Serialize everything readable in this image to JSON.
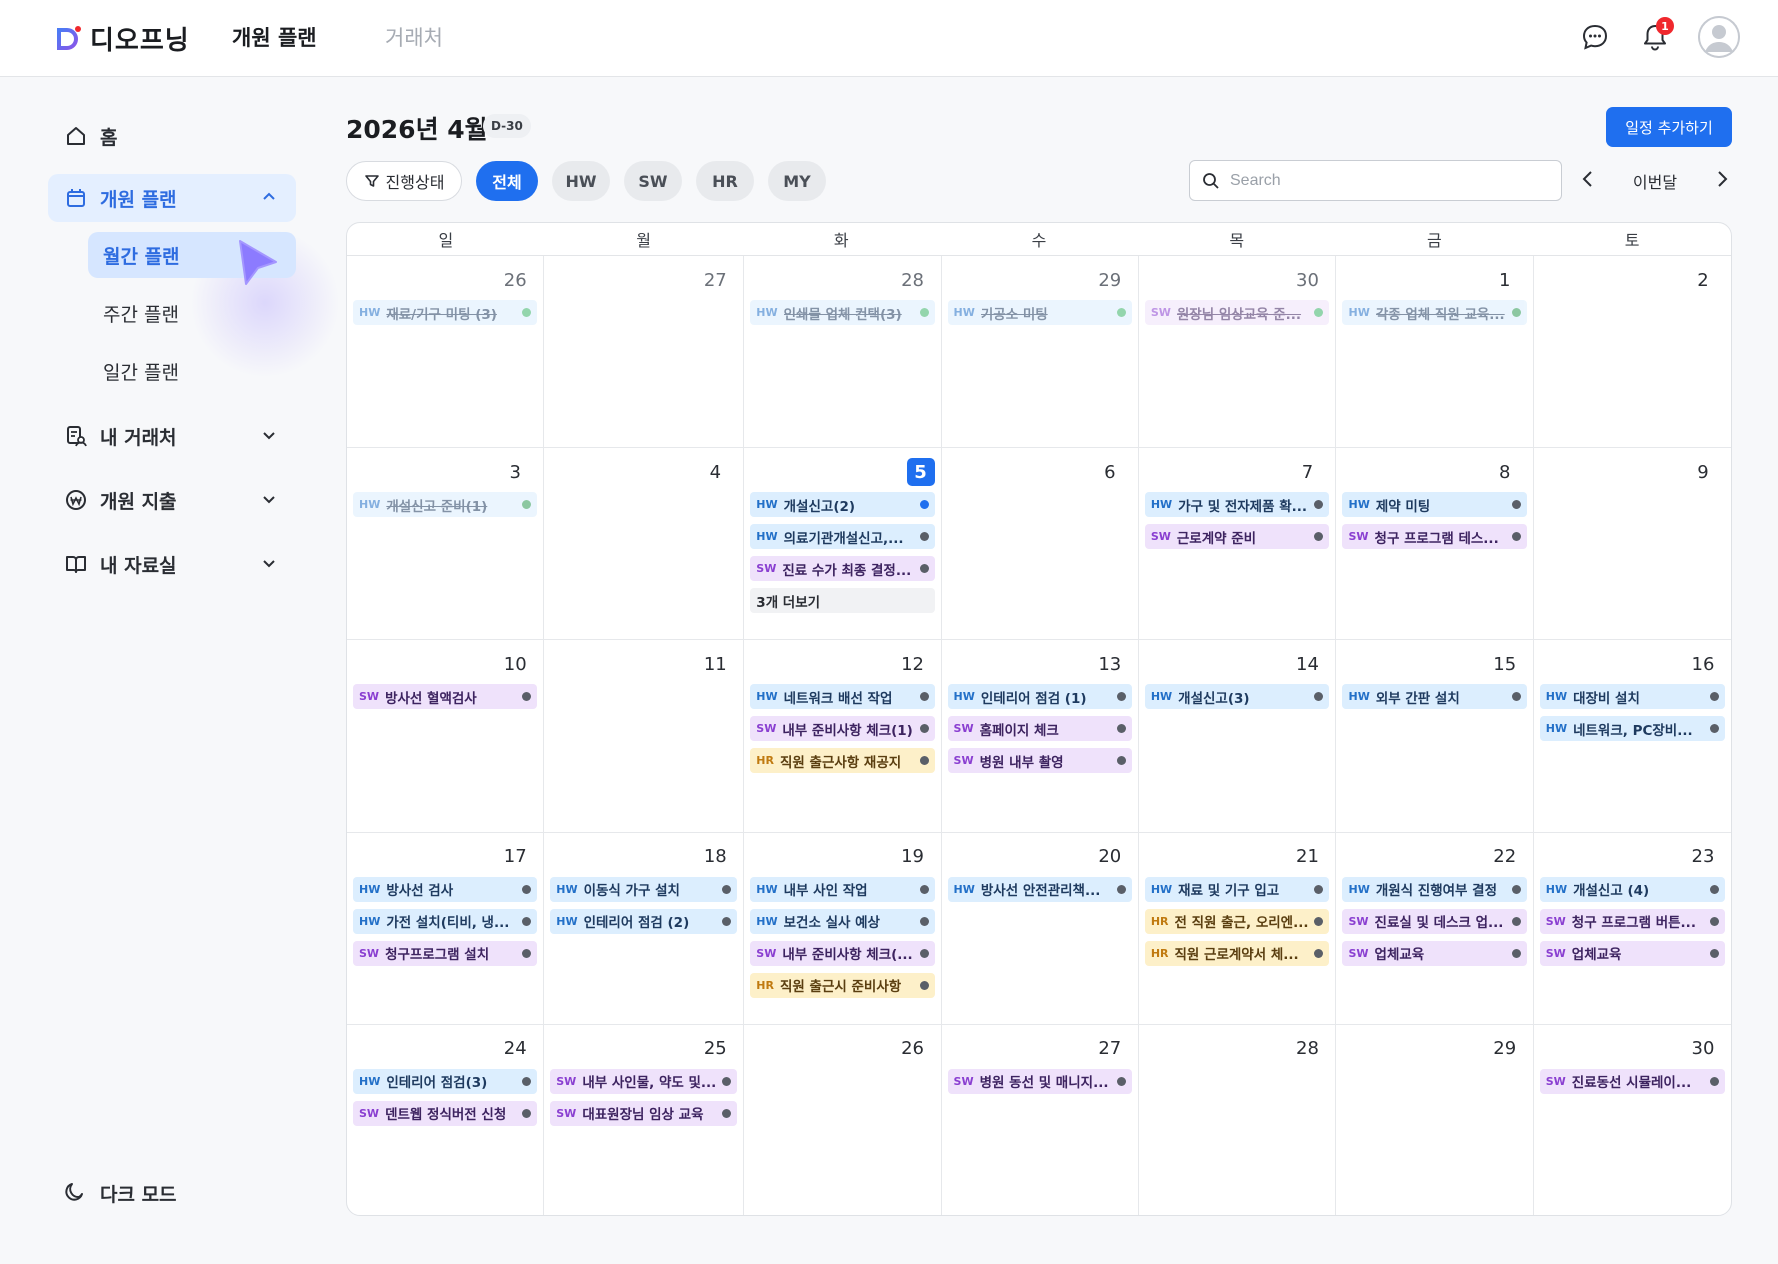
{
  "app": {
    "brand": "디오프닝"
  },
  "topnav": {
    "tabs": [
      {
        "label": "개원 플랜",
        "active": true
      },
      {
        "label": "거래처",
        "active": false
      }
    ]
  },
  "header": {
    "notification_count": "1"
  },
  "sidebar": {
    "home": "홈",
    "plan": "개원 플랜",
    "sub": [
      "월간 플랜",
      "주간 플랜",
      "일간 플랜"
    ],
    "clients": "내 거래처",
    "expense": "개원 지출",
    "library": "내 자료실",
    "dark_mode": "다크 모드"
  },
  "main": {
    "title": "2026년 4월",
    "dday": "D-30",
    "add_button": "일정 추가하기",
    "filters": {
      "status": "진행상태",
      "all": "전체",
      "categories": [
        "HW",
        "SW",
        "HR",
        "MY"
      ]
    },
    "search": {
      "placeholder": "Search",
      "value": ""
    },
    "month_label": "이번달"
  },
  "calendar": {
    "weekdays": [
      "일",
      "월",
      "화",
      "수",
      "목",
      "금",
      "토"
    ],
    "today": "5",
    "more_label": "3개 더보기",
    "weeks": [
      [
        {
          "day": "26",
          "events": [
            {
              "cat": "HW",
              "text": "재료/기구 미팅 (3)",
              "done": true,
              "dot": "#3bb36a"
            }
          ]
        },
        {
          "day": "27",
          "events": []
        },
        {
          "day": "28",
          "events": [
            {
              "cat": "HW",
              "text": "인쇄물 업체 컨택(3)",
              "done": true,
              "dot": "#3bb36a"
            }
          ]
        },
        {
          "day": "29",
          "events": [
            {
              "cat": "HW",
              "text": "기공소 미팅",
              "done": true,
              "dot": "#3bb36a"
            }
          ]
        },
        {
          "day": "30",
          "events": [
            {
              "cat": "SW",
              "text": "원장님 임상교육 준...",
              "done": true,
              "dot": "#3bb36a"
            }
          ]
        },
        {
          "day": "1",
          "events": [
            {
              "cat": "HW",
              "text": "각종 업체 직원 교육...",
              "done": true,
              "dot": "#2f9b55",
              "strong": true
            }
          ]
        },
        {
          "day": "2",
          "events": []
        }
      ],
      [
        {
          "day": "3",
          "events": [
            {
              "cat": "HW",
              "text": "개설신고 준비(1)",
              "done": true,
              "dot": "#2f9b55",
              "strong": true
            }
          ]
        },
        {
          "day": "4",
          "events": []
        },
        {
          "day": "5",
          "events": [
            {
              "cat": "HW",
              "text": "개설신고(2)",
              "dot": "#1f6fef"
            },
            {
              "cat": "HW",
              "text": "의료기관개설신고,..."
            },
            {
              "cat": "SW",
              "text": "진료 수가 최종 결정..."
            }
          ],
          "more": true
        },
        {
          "day": "6",
          "events": []
        },
        {
          "day": "7",
          "events": [
            {
              "cat": "HW",
              "text": "가구 및 전자제품 확..."
            },
            {
              "cat": "SW",
              "text": "근로계약 준비"
            }
          ]
        },
        {
          "day": "8",
          "events": [
            {
              "cat": "HW",
              "text": "제약 미팅"
            },
            {
              "cat": "SW",
              "text": "청구 프로그램 테스..."
            }
          ]
        },
        {
          "day": "9",
          "events": []
        }
      ],
      [
        {
          "day": "10",
          "events": [
            {
              "cat": "SW",
              "text": "방사선 혈액검사"
            }
          ]
        },
        {
          "day": "11",
          "events": []
        },
        {
          "day": "12",
          "events": [
            {
              "cat": "HW",
              "text": "네트워크 배선 작업"
            },
            {
              "cat": "SW",
              "text": "내부 준비사항 체크(1)"
            },
            {
              "cat": "HR",
              "text": "직원 출근사항 재공지"
            }
          ]
        },
        {
          "day": "13",
          "events": [
            {
              "cat": "HW",
              "text": "인테리어 점검 (1)"
            },
            {
              "cat": "SW",
              "text": "홈페이지 체크"
            },
            {
              "cat": "SW",
              "text": "병원 내부 촬영"
            }
          ]
        },
        {
          "day": "14",
          "events": [
            {
              "cat": "HW",
              "text": "개설신고(3)"
            }
          ]
        },
        {
          "day": "15",
          "events": [
            {
              "cat": "HW",
              "text": "외부 간판 설치"
            }
          ]
        },
        {
          "day": "16",
          "events": [
            {
              "cat": "HW",
              "text": "대장비 설치"
            },
            {
              "cat": "HW",
              "text": "네트워크, PC장비..."
            }
          ]
        }
      ],
      [
        {
          "day": "17",
          "events": [
            {
              "cat": "HW",
              "text": "방사선 검사"
            },
            {
              "cat": "HW",
              "text": "가전 설치(티비, 냉..."
            },
            {
              "cat": "SW",
              "text": "청구프로그램 설치"
            }
          ]
        },
        {
          "day": "18",
          "events": [
            {
              "cat": "HW",
              "text": "이동식 가구 설치"
            },
            {
              "cat": "HW",
              "text": "인테리어 점검 (2)"
            }
          ]
        },
        {
          "day": "19",
          "events": [
            {
              "cat": "HW",
              "text": "내부 사인 작업"
            },
            {
              "cat": "HW",
              "text": "보건소 실사 예상"
            },
            {
              "cat": "SW",
              "text": "내부 준비사항 체크(..."
            },
            {
              "cat": "HR",
              "text": "직원 출근시 준비사항"
            }
          ]
        },
        {
          "day": "20",
          "events": [
            {
              "cat": "HW",
              "text": "방사선 안전관리책..."
            }
          ]
        },
        {
          "day": "21",
          "events": [
            {
              "cat": "HW",
              "text": "재료 및 기구 입고"
            },
            {
              "cat": "HR",
              "text": "전 직원 출근, 오리엔..."
            },
            {
              "cat": "HR",
              "text": "직원 근로계약서 체..."
            }
          ]
        },
        {
          "day": "22",
          "events": [
            {
              "cat": "HW",
              "text": "개원식 진행여부 결정"
            },
            {
              "cat": "SW",
              "text": "진료실 및 데스크 업..."
            },
            {
              "cat": "SW",
              "text": "업체교육"
            }
          ]
        },
        {
          "day": "23",
          "events": [
            {
              "cat": "HW",
              "text": "개설신고 (4)"
            },
            {
              "cat": "SW",
              "text": "청구 프로그램 버튼..."
            },
            {
              "cat": "SW",
              "text": "업체교육"
            }
          ]
        }
      ],
      [
        {
          "day": "24",
          "events": [
            {
              "cat": "HW",
              "text": "인테리어 점검(3)"
            },
            {
              "cat": "SW",
              "text": "덴트웹 정식버전 신청"
            }
          ]
        },
        {
          "day": "25",
          "events": [
            {
              "cat": "SW",
              "text": "내부 사인물, 약도 및..."
            },
            {
              "cat": "SW",
              "text": "대표원장님 임상 교육"
            }
          ]
        },
        {
          "day": "26",
          "events": []
        },
        {
          "day": "27",
          "events": [
            {
              "cat": "SW",
              "text": "병원 동선 및 매니지..."
            }
          ]
        },
        {
          "day": "28",
          "events": []
        },
        {
          "day": "29",
          "events": []
        },
        {
          "day": "30",
          "events": [
            {
              "cat": "SW",
              "text": "진료동선 시뮬레이..."
            }
          ]
        }
      ]
    ]
  }
}
